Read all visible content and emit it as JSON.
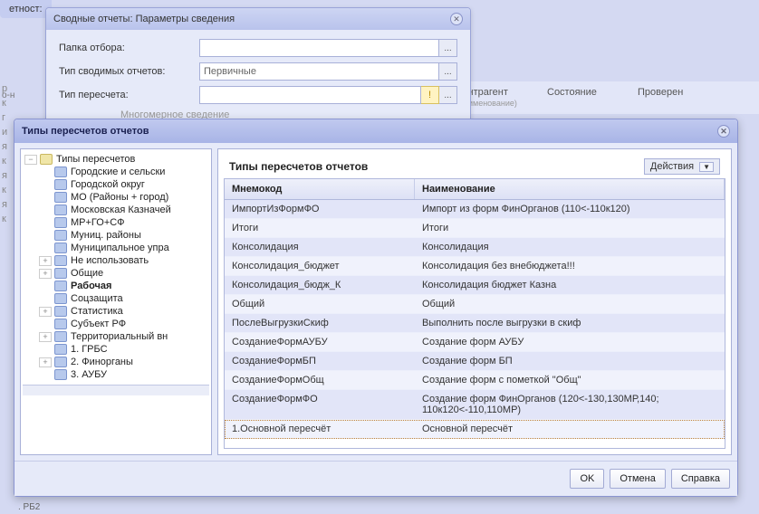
{
  "bg": {
    "tab": "етност:",
    "cols": [
      "Контрагент",
      "Состояние",
      "Проверен"
    ],
    "col_sub": "(наименование)",
    "side_letter": "о-н",
    "side": [
      "р",
      "к",
      "г",
      "и",
      "я",
      "к",
      "я",
      "к",
      "я",
      "к"
    ],
    "rb2": ". РБ2"
  },
  "dialog1": {
    "title": "Сводные отчеты: Параметры сведения",
    "folder_label": "Папка отбора:",
    "type_label": "Тип сводимых отчетов:",
    "type_value": "Первичные",
    "recalc_label": "Тип пересчета:",
    "multilevel": "Многомерное сведение",
    "ellipsis": "...",
    "warn": "!"
  },
  "dialog2": {
    "title": "Типы пересчетов отчетов",
    "panel_title": "Типы пересчетов отчетов",
    "actions": "Действия",
    "col_mnemo": "Мнемокод",
    "col_name": "Наименование",
    "tree_root": "Типы пересчетов",
    "tree": [
      {
        "label": "Городские и сельски"
      },
      {
        "label": "Городской округ"
      },
      {
        "label": "МО (Районы + город)"
      },
      {
        "label": "Московская Казначей"
      },
      {
        "label": "МР+ГО+СФ"
      },
      {
        "label": "Муниц. районы"
      },
      {
        "label": "Муниципальное упра"
      },
      {
        "label": "Не использовать",
        "expand": "+"
      },
      {
        "label": "Общие",
        "expand": "+"
      },
      {
        "label": "Рабочая",
        "bold": true
      },
      {
        "label": "Соцзащита"
      },
      {
        "label": "Статистика",
        "expand": "+"
      },
      {
        "label": "Субъект РФ"
      },
      {
        "label": "Территориальный вн",
        "expand": "+"
      },
      {
        "label": "1. ГРБС"
      },
      {
        "label": "2. Финорганы",
        "expand": "+"
      },
      {
        "label": "3. АУБУ"
      }
    ],
    "rows": [
      {
        "m": "ИмпортИзФормФО",
        "n": "Импорт из форм ФинОрганов (110<-110к120)"
      },
      {
        "m": "Итоги",
        "n": "Итоги"
      },
      {
        "m": "Консолидация",
        "n": "Консолидация"
      },
      {
        "m": "Консолидация_бюджет",
        "n": "Консолидация без внебюджета!!!"
      },
      {
        "m": "Консолидация_бюдж_К",
        "n": "Консолидация бюджет Казна"
      },
      {
        "m": "Общий",
        "n": "Общий"
      },
      {
        "m": "ПослеВыгрузкиСкиф",
        "n": "Выполнить после выгрузки в скиф"
      },
      {
        "m": "СозданиеФормАУБУ",
        "n": "Создание форм АУБУ"
      },
      {
        "m": "СозданиеФормБП",
        "n": "Создание форм БП"
      },
      {
        "m": "СозданиеФормОбщ",
        "n": "Создание форм с пометкой \"Общ\""
      },
      {
        "m": "СозданиеФормФО",
        "n": "Создание форм ФинОрганов (120<-130,130МР,140; 110к120<-110,110МР)"
      },
      {
        "m": "1.Основной пересчёт",
        "n": "Основной пересчёт",
        "sel": true
      }
    ],
    "ok": "OK",
    "cancel": "Отмена",
    "help": "Справка"
  }
}
